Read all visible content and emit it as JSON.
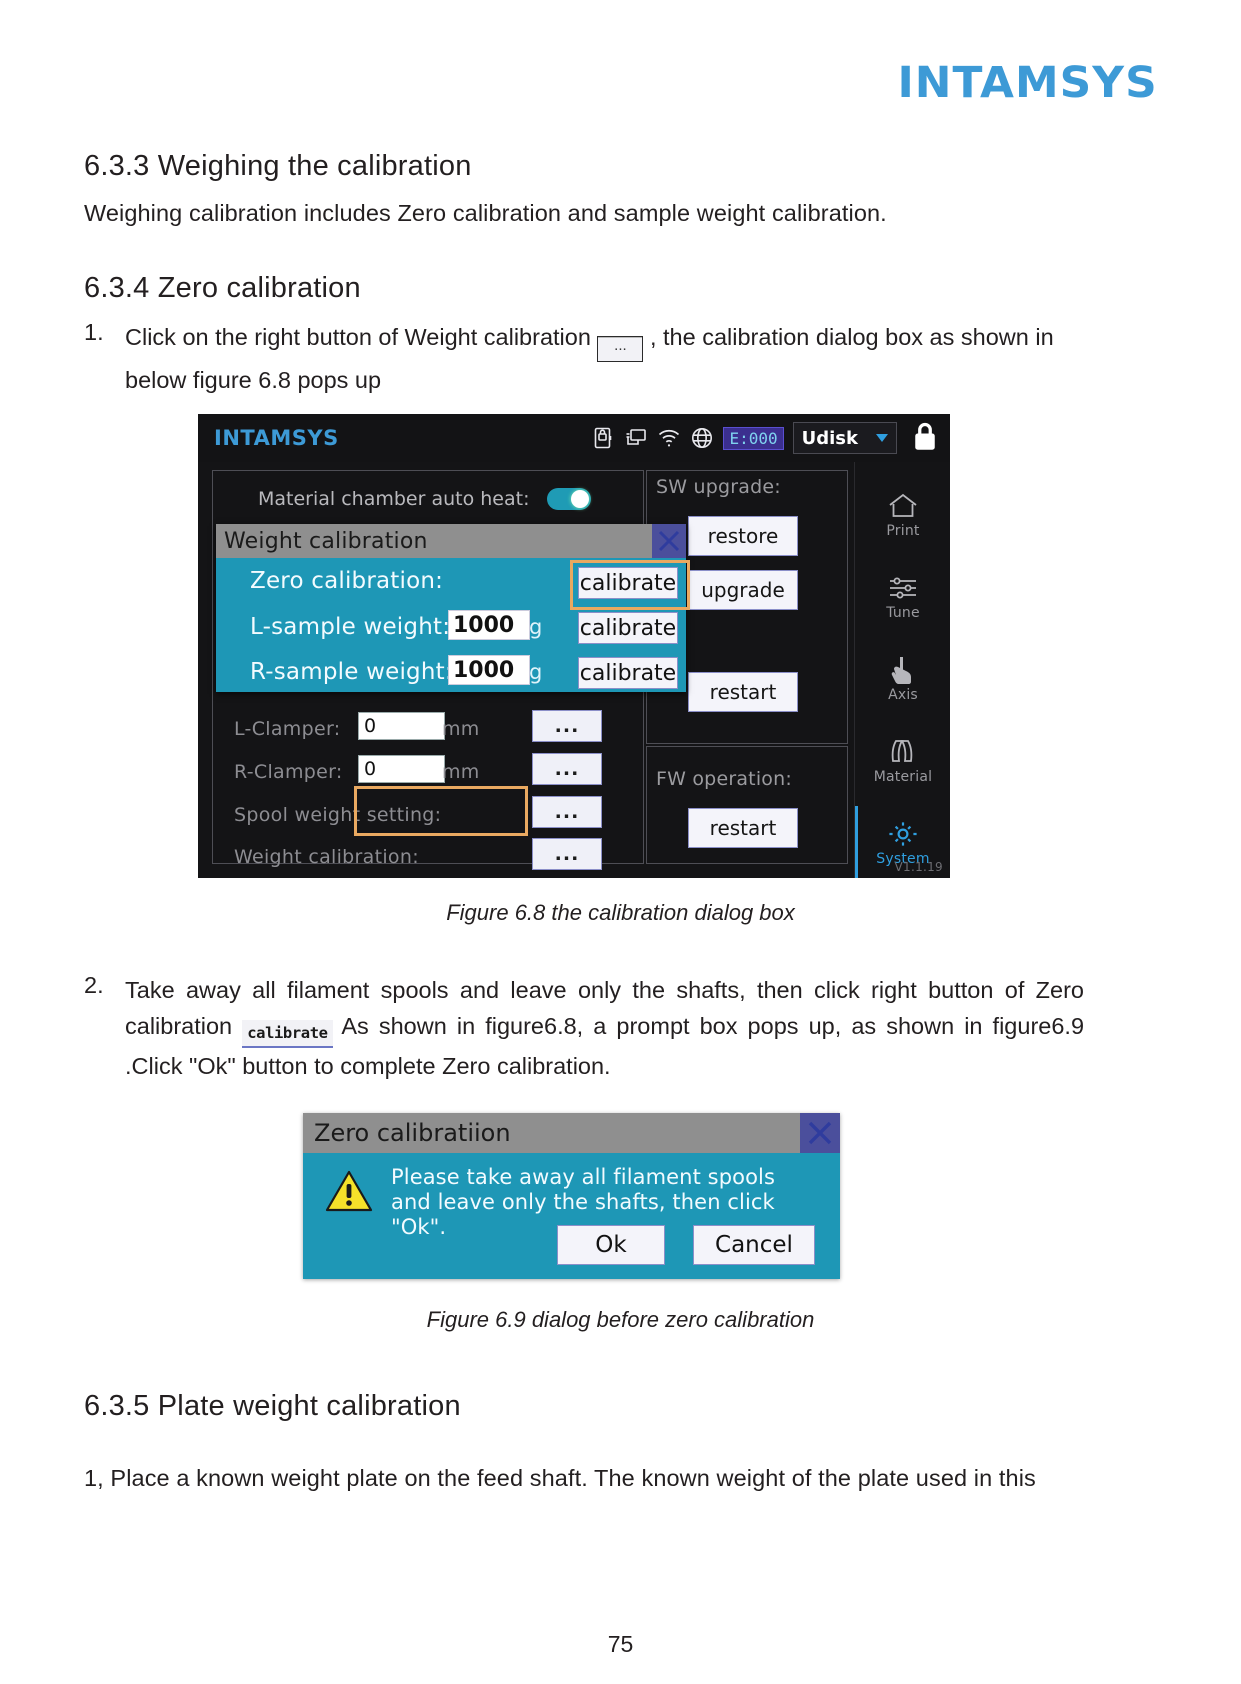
{
  "brand": {
    "logo": "INTAMSYS"
  },
  "document": {
    "section1": {
      "heading": "6.3.3 Weighing the calibration",
      "paragraph": "Weighing calibration includes Zero calibration and sample weight calibration."
    },
    "section2": {
      "heading": "6.3.4 Zero calibration"
    },
    "step1": {
      "number": "1.",
      "text_before": "Click on the right button of Weight calibration",
      "inline_button": "...",
      "text_after": ",  the calibration dialog box as shown in below figure 6.8 pops up"
    },
    "caption68": "Figure 6.8 the calibration dialog box",
    "step2": {
      "number": "2.",
      "text_before": "Take away all filament spools and leave only the shafts, then click right button of Zero calibration",
      "inline_button": "calibrate",
      "text_after": "As shown in figure6.8, a prompt box pops up, as shown in figure6.9 .Click \"Ok\" button to complete Zero calibration."
    },
    "caption69": "Figure 6.9 dialog before zero calibration",
    "section3": {
      "heading": "6.3.5 Plate weight calibration"
    },
    "step3": {
      "text": "1, Place a known weight plate on the feed shaft. The known weight of the plate used in this"
    },
    "page_number": "75"
  },
  "figure68": {
    "topbar": {
      "logo": "INTAMSYS",
      "icons": [
        "sd-card-lock-icon",
        "network-icon",
        "wifi-icon",
        "globe-icon"
      ],
      "error_badge": "E:000",
      "storage_label": "Udisk",
      "lock": "lock-icon"
    },
    "left_pane": {
      "auto_heat_label": "Material chamber auto heat:",
      "auto_heat_on": true,
      "rows": [
        {
          "label": "L-Clamper:",
          "value": "0",
          "unit": "mm",
          "button": "..."
        },
        {
          "label": "R-Clamper:",
          "value": "0",
          "unit": "mm",
          "button": "..."
        },
        {
          "label": "Spool weight setting:",
          "value": "",
          "unit": "",
          "button": "..."
        },
        {
          "label": "Weight calibration:",
          "value": "",
          "unit": "",
          "button": "..."
        }
      ]
    },
    "right_panes": {
      "sw_upgrade_title": "SW upgrade:",
      "sw_buttons": [
        "restore",
        "upgrade",
        "restart"
      ],
      "fw_operation_title": "FW operation:",
      "fw_buttons": [
        "restart"
      ]
    },
    "modal": {
      "title": "Weight calibration",
      "close": "close-icon",
      "rows": [
        {
          "label": "Zero calibration:",
          "value": "",
          "unit": "",
          "button": "calibrate",
          "highlighted": true
        },
        {
          "label": "L-sample weight:",
          "value": "1000",
          "unit": "g",
          "button": "calibrate",
          "highlighted": false
        },
        {
          "label": "R-sample weight:",
          "value": "1000",
          "unit": "g",
          "button": "calibrate",
          "highlighted": false
        }
      ]
    },
    "rail": {
      "items": [
        {
          "label": "Print",
          "icon": "home-icon",
          "active": false
        },
        {
          "label": "Tune",
          "icon": "sliders-icon",
          "active": false
        },
        {
          "label": "Axis",
          "icon": "hand-touch-icon",
          "active": false
        },
        {
          "label": "Material",
          "icon": "spool-icon",
          "active": false
        },
        {
          "label": "System",
          "icon": "gear-icon",
          "active": true
        }
      ],
      "version": "V1.1.19"
    },
    "colors": {
      "accent": "#2f9fe0",
      "dialog_body": "#1e97b6",
      "titlebar": "#8f8f8f",
      "highlight": "#e9a961"
    }
  },
  "figure69": {
    "title": "Zero calibratiion",
    "close": "close-icon",
    "warning_icon": "warning-triangle-icon",
    "message": "Please take away all filament spools and leave only the shafts, then click \"Ok\".",
    "ok_label": "Ok",
    "cancel_label": "Cancel"
  }
}
